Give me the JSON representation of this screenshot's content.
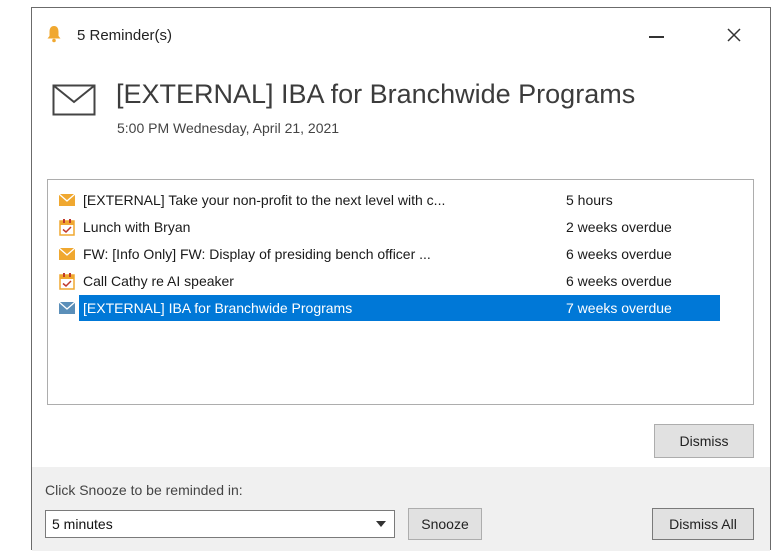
{
  "window": {
    "title": "5 Reminder(s)"
  },
  "header": {
    "subject": "[EXTERNAL] IBA for Branchwide Programs",
    "due": "5:00 PM Wednesday, April 21, 2021"
  },
  "reminders": [
    {
      "icon": "mail-icon",
      "subject": "[EXTERNAL] Take your non-profit to the next level with c...",
      "due": "5 hours"
    },
    {
      "icon": "calendar-icon",
      "subject": "Lunch with Bryan",
      "due": "2 weeks overdue"
    },
    {
      "icon": "mail-icon",
      "subject": "FW: [Info Only] FW: Display of presiding bench officer ...",
      "due": "6 weeks overdue"
    },
    {
      "icon": "calendar-icon",
      "subject": "Call Cathy re AI speaker",
      "due": "6 weeks overdue"
    },
    {
      "icon": "mail-icon",
      "subject": "[EXTERNAL] IBA for Branchwide Programs",
      "due": "7 weeks overdue",
      "selected": true
    }
  ],
  "buttons": {
    "dismiss": "Dismiss",
    "snooze": "Snooze",
    "dismiss_all": "Dismiss All"
  },
  "snooze": {
    "label": "Click Snooze to be reminded in:",
    "value": "5 minutes"
  },
  "colors": {
    "selection": "#0078d7",
    "bell": "#f0a830",
    "mail_icon": "#f0a830",
    "selected_mail_icon": "#5b8fb9"
  }
}
